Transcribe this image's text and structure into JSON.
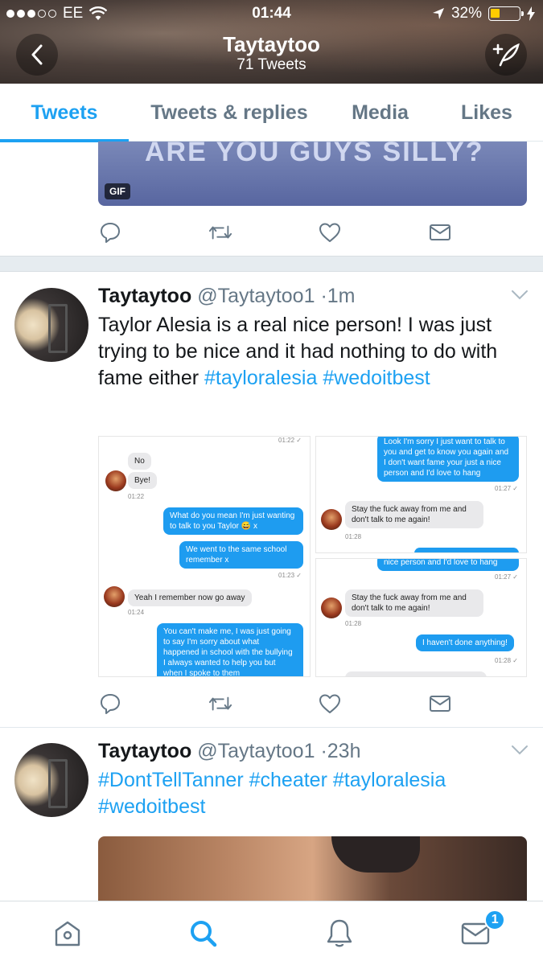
{
  "status_bar": {
    "carrier": "EE",
    "time": "01:44",
    "battery": "32%",
    "battery_level": 0.32,
    "signal_bars": 3
  },
  "header": {
    "name": "Taytaytoo",
    "tweet_count": "71 Tweets"
  },
  "tabs": [
    {
      "label": "Tweets",
      "active": true
    },
    {
      "label": "Tweets & replies",
      "active": false
    },
    {
      "label": "Media",
      "active": false
    },
    {
      "label": "Likes",
      "active": false
    }
  ],
  "gif_tweet": {
    "overlay_text": "ARE YOU GUYS SILLY?",
    "badge": "GIF"
  },
  "tweets": [
    {
      "display_name": "Taytaytoo",
      "handle": "@Taytaytoo1",
      "sep": "·",
      "time": "1m",
      "text_plain": "Taylor Alesia is a real nice person! I was just trying to be nice and it had nothing to do with fame either",
      "hashtags": [
        "#tayloralesia",
        "#wedoitbest"
      ]
    },
    {
      "display_name": "Taytaytoo",
      "handle": "@Taytaytoo1",
      "sep": "·",
      "time": "23h",
      "hashtags_line1": [
        "#DontTellTanner",
        "#cheater",
        "#tayloralesia"
      ],
      "hashtags_line2": [
        "#wedoitbest"
      ]
    }
  ],
  "chat_left": {
    "top_ts": "01:22 ✓",
    "m1": "No",
    "m2": "Bye!",
    "ts2": "01:22",
    "m3": "What do you mean I'm just wanting to talk to you Taylor 😅 x",
    "m4": "We went to the same school remember x",
    "ts3": "01:23 ✓",
    "m5": "Yeah I remember now go away",
    "ts4": "01:24",
    "m6": "You can't make me, I was just going to say I'm sorry about what happened in school with the bullying I always wanted to help you but when I spoke to them"
  },
  "chat_right_top": {
    "m1": "Look I'm sorry I just want to talk to you and get to know you again and I don't want fame your just a nice person and I'd love to hang",
    "ts1": "01:27 ✓",
    "m2": "Stay the fuck away from me and don't talk to me again!",
    "ts2": "01:28"
  },
  "chat_right_bottom": {
    "m0": "nice person and I'd love to hang",
    "ts0": "01:27 ✓",
    "m1": "Stay the fuck away from me and don't talk to me again!",
    "ts1": "01:28",
    "m2": "I haven't done anything!",
    "ts2": "01:28 ✓"
  },
  "bottom_nav": {
    "items": [
      "home-icon",
      "search-icon",
      "notifications-icon",
      "messages-icon"
    ],
    "active": "search-icon",
    "messages_badge": "1"
  },
  "colors": {
    "accent": "#1da1f2",
    "secondary_text": "#657786",
    "action_icon": "#657786"
  }
}
